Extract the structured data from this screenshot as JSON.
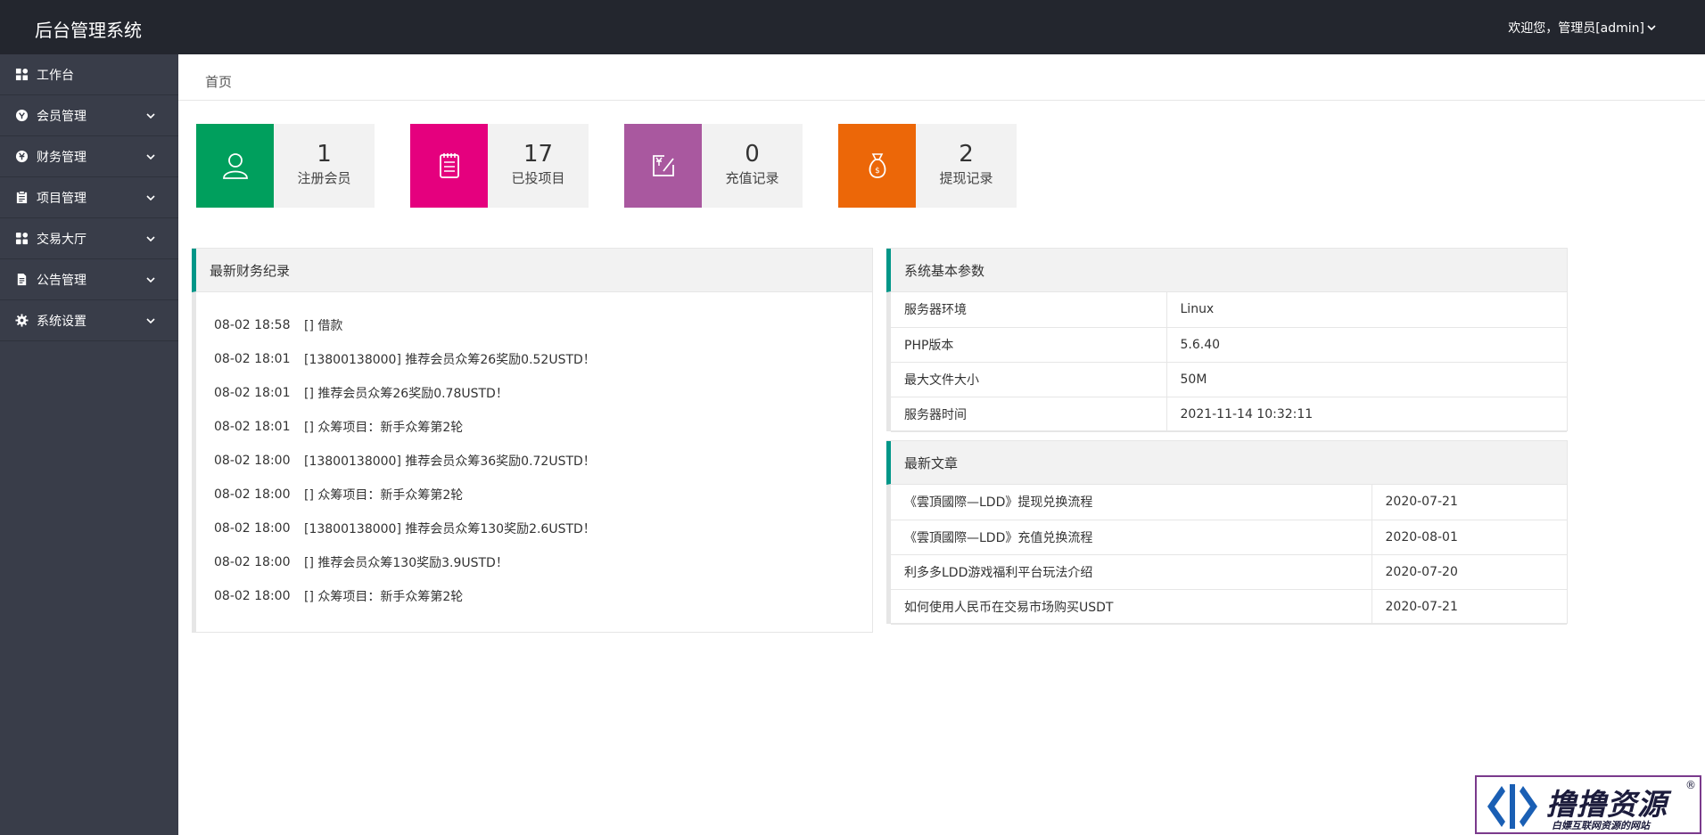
{
  "header": {
    "title": "后台管理系统",
    "user_greeting": "欢迎您，管理员[admin]"
  },
  "sidebar": {
    "items": [
      {
        "label": "工作台",
        "icon": "dashboard-icon"
      },
      {
        "label": "会员管理",
        "icon": "member-icon"
      },
      {
        "label": "财务管理",
        "icon": "finance-icon"
      },
      {
        "label": "项目管理",
        "icon": "clipboard-icon"
      },
      {
        "label": "交易大厅",
        "icon": "grid-icon"
      },
      {
        "label": "公告管理",
        "icon": "document-icon"
      },
      {
        "label": "系统设置",
        "icon": "gear-icon"
      }
    ]
  },
  "breadcrumb": {
    "home": "首页"
  },
  "stats": [
    {
      "value": "1",
      "label": "注册会员",
      "color": "#009f5d",
      "icon": "user-icon"
    },
    {
      "value": "17",
      "label": "已投项目",
      "color": "#e5007e",
      "icon": "notepad-icon"
    },
    {
      "value": "0",
      "label": "充值记录",
      "color": "#a9589f",
      "icon": "recharge-icon"
    },
    {
      "value": "2",
      "label": "提现记录",
      "color": "#ec6708",
      "icon": "moneybag-icon"
    }
  ],
  "finance": {
    "title": "最新财务纪录",
    "records": [
      {
        "time": "08-02 18:58",
        "text": "[] 借款"
      },
      {
        "time": "08-02 18:01",
        "text": "[13800138000] 推荐会员众筹26奖励0.52USTD！"
      },
      {
        "time": "08-02 18:01",
        "text": "[] 推荐会员众筹26奖励0.78USTD！"
      },
      {
        "time": "08-02 18:01",
        "text": "[] 众筹项目：新手众筹第2轮"
      },
      {
        "time": "08-02 18:00",
        "text": "[13800138000] 推荐会员众筹36奖励0.72USTD！"
      },
      {
        "time": "08-02 18:00",
        "text": "[] 众筹项目：新手众筹第2轮"
      },
      {
        "time": "08-02 18:00",
        "text": "[13800138000] 推荐会员众筹130奖励2.6USTD！"
      },
      {
        "time": "08-02 18:00",
        "text": "[] 推荐会员众筹130奖励3.9USTD！"
      },
      {
        "time": "08-02 18:00",
        "text": "[] 众筹项目：新手众筹第2轮"
      }
    ]
  },
  "system": {
    "title": "系统基本参数",
    "rows": [
      {
        "key": "服务器环境",
        "value": "Linux"
      },
      {
        "key": "PHP版本",
        "value": "5.6.40"
      },
      {
        "key": "最大文件大小",
        "value": "50M"
      },
      {
        "key": "服务器时间",
        "value": "2021-11-14 10:32:11"
      }
    ]
  },
  "articles": {
    "title": "最新文章",
    "rows": [
      {
        "title": "《雲頂國際—LDD》提现兑换流程",
        "date": "2020-07-21"
      },
      {
        "title": "《雲頂國際—LDD》充值兑换流程",
        "date": "2020-08-01"
      },
      {
        "title": "利多多LDD游戏福利平台玩法介绍",
        "date": "2020-07-20"
      },
      {
        "title": "如何使用人民币在交易市场购买USDT",
        "date": "2020-07-21"
      }
    ]
  },
  "watermark": {
    "name": "撸撸资源",
    "slogan": "白嫖互联网资源的网站",
    "reg": "®"
  }
}
